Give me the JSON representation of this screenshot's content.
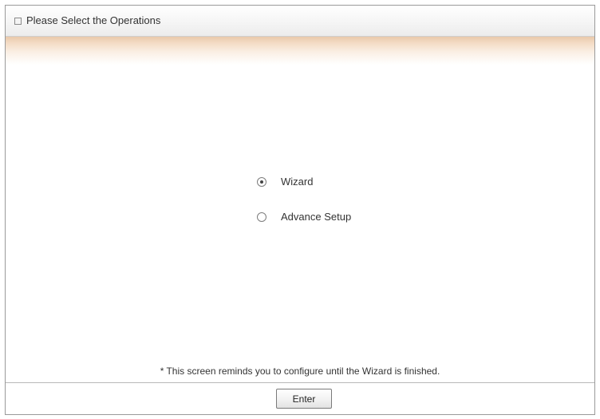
{
  "header": {
    "title": "Please Select the Operations",
    "icon": "square-bullet-icon"
  },
  "operations": {
    "options": [
      {
        "label": "Wizard",
        "selected": true
      },
      {
        "label": "Advance Setup",
        "selected": false
      }
    ]
  },
  "footer": {
    "note": "* This screen reminds you to configure until the Wizard is finished.",
    "enter_label": "Enter"
  },
  "colors": {
    "border": "#9a9a9a",
    "band": "#f3dbc5",
    "text": "#333333"
  }
}
